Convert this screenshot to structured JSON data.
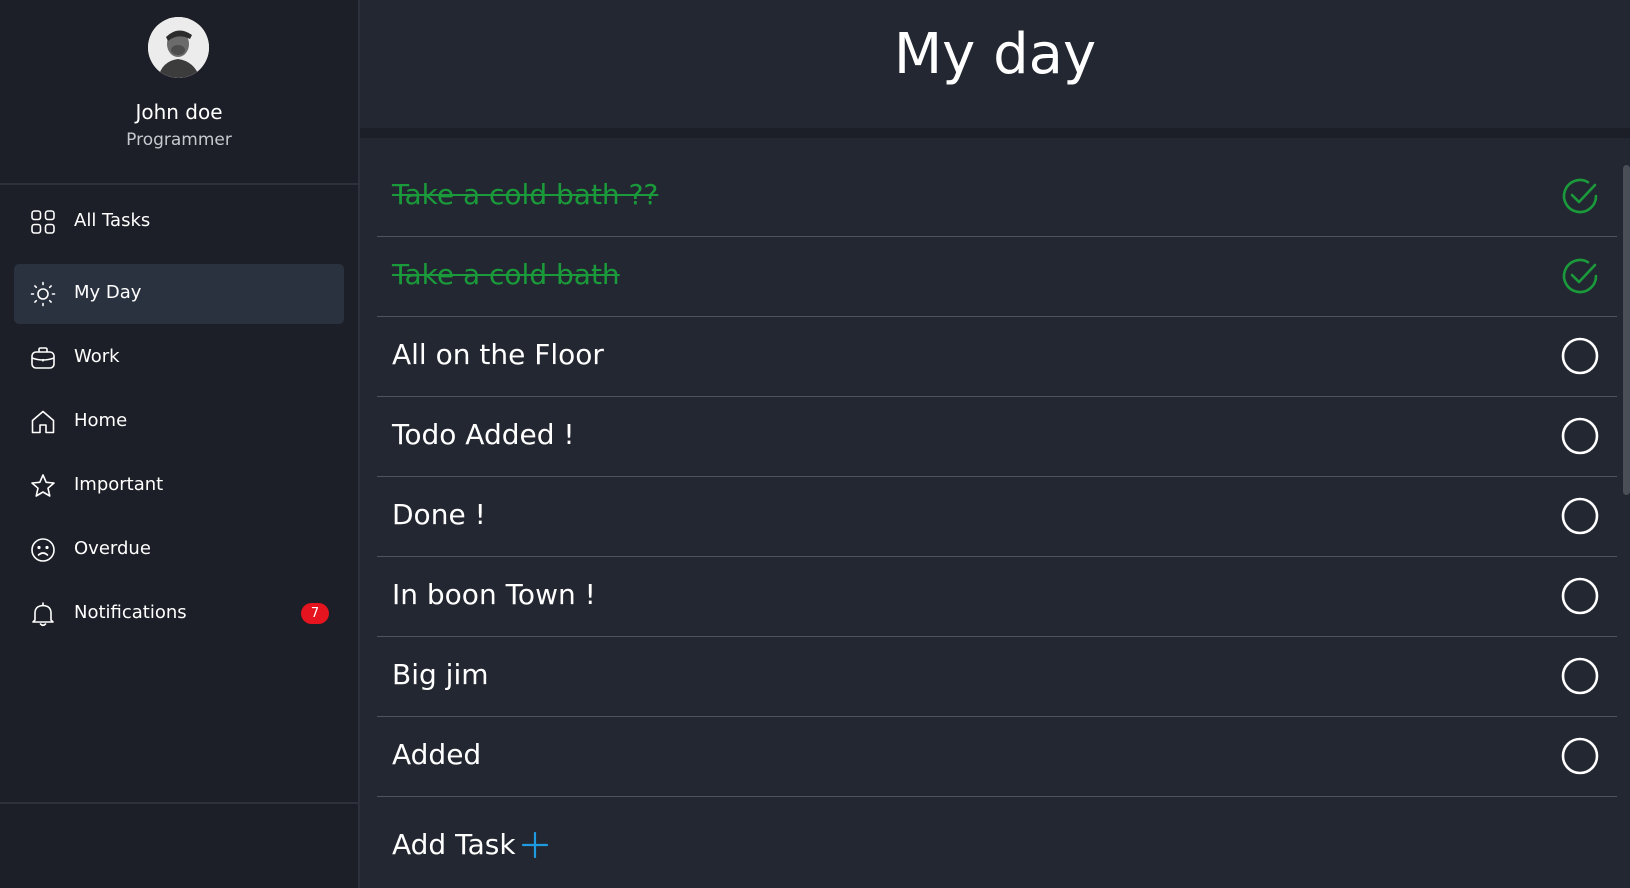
{
  "profile": {
    "name": "John doe",
    "role": "Programmer"
  },
  "sidebar": {
    "items": [
      {
        "label": "All Tasks",
        "icon": "grid-icon"
      },
      {
        "label": "My Day",
        "icon": "sun-icon",
        "active": true
      },
      {
        "label": "Work",
        "icon": "briefcase-icon"
      },
      {
        "label": "Home",
        "icon": "home-icon"
      },
      {
        "label": "Important",
        "icon": "star-icon"
      },
      {
        "label": "Overdue",
        "icon": "sad-face-icon"
      },
      {
        "label": "Notifications",
        "icon": "bell-icon",
        "badge": "7"
      }
    ]
  },
  "main": {
    "title": "My day",
    "tasks": [
      {
        "text": "Take a cold bath ??",
        "done": true
      },
      {
        "text": "Take a cold bath",
        "done": true
      },
      {
        "text": "All on the Floor",
        "done": false
      },
      {
        "text": "Todo Added !",
        "done": false
      },
      {
        "text": "Done !",
        "done": false
      },
      {
        "text": "In boon Town !",
        "done": false
      },
      {
        "text": "Big jim",
        "done": false
      },
      {
        "text": "Added",
        "done": false
      }
    ],
    "add_task_label": "Add Task"
  },
  "colors": {
    "done": "#1a9a3a",
    "badge": "#e5141f",
    "add_icon": "#1e9be0",
    "active_nav": "#2b323f"
  }
}
